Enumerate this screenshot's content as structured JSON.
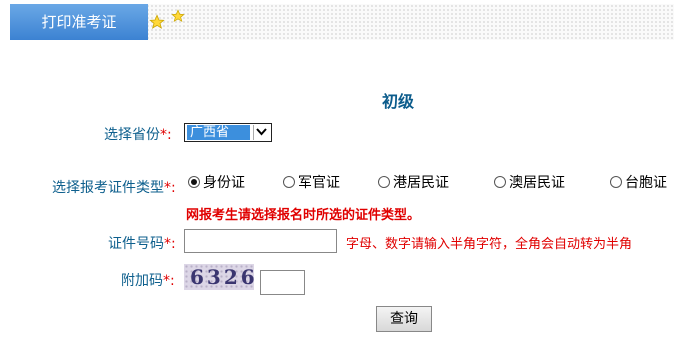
{
  "header": {
    "tab_label": "打印准考证"
  },
  "form": {
    "level_title": "初级",
    "province": {
      "label": "选择省份",
      "required_mark": "*:",
      "selected": "广西省"
    },
    "id_type": {
      "label": "选择报考证件类型",
      "required_mark": "*:",
      "options": [
        {
          "label": "身份证",
          "checked": true
        },
        {
          "label": "军官证",
          "checked": false
        },
        {
          "label": "港居民证",
          "checked": false
        },
        {
          "label": "澳居民证",
          "checked": false
        },
        {
          "label": "台胞证",
          "checked": false
        }
      ],
      "warning": "网报考生请选择报名时所选的证件类型。"
    },
    "id_number": {
      "label": "证件号码",
      "required_mark": "*:",
      "value": "",
      "hint": "字母、数字请输入半角字符，全角会自动转为半角"
    },
    "captcha": {
      "label": "附加码",
      "required_mark": "*:",
      "image_text": "6326",
      "value": ""
    },
    "submit_label": "查询"
  }
}
